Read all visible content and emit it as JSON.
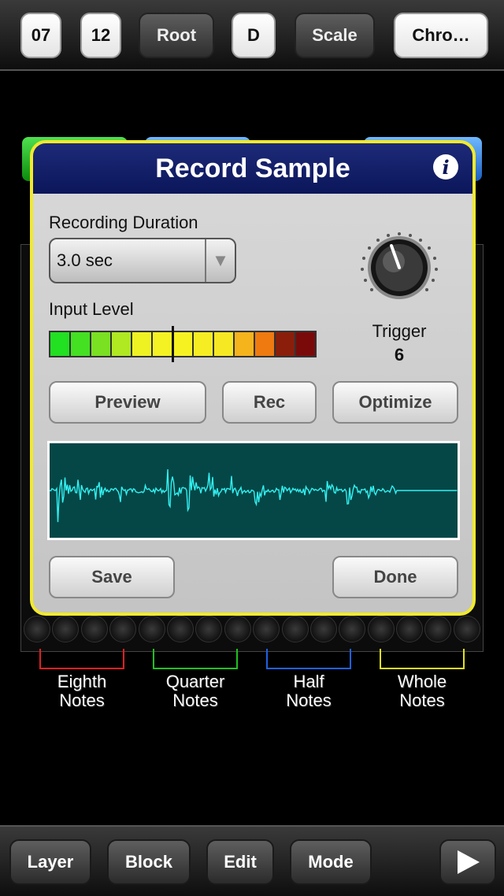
{
  "toolbar": {
    "items": [
      "07",
      "12",
      "Root",
      "D",
      "Scale",
      "Chro…"
    ]
  },
  "dialog": {
    "title": "Record Sample",
    "duration_label": "Recording Duration",
    "duration_value": "3.0 sec",
    "input_level_label": "Input Level",
    "trigger_label": "Trigger",
    "trigger_value": "6",
    "buttons": {
      "preview": "Preview",
      "rec": "Rec",
      "optimize": "Optimize",
      "save": "Save",
      "done": "Done"
    }
  },
  "note_labels": [
    {
      "line1": "Eighth",
      "line2": "Notes",
      "color": "#e02020"
    },
    {
      "line1": "Quarter",
      "line2": "Notes",
      "color": "#20c020"
    },
    {
      "line1": "Half",
      "line2": "Notes",
      "color": "#2060e0"
    },
    {
      "line1": "Whole",
      "line2": "Notes",
      "color": "#e0e020"
    }
  ],
  "bottom_bar": {
    "layer": "Layer",
    "block": "Block",
    "edit": "Edit",
    "mode": "Mode"
  },
  "colors": {
    "dialog_border": "#f1ea2c",
    "header": "#0b165a",
    "waveform": "#33f0f0",
    "waveform_bg": "#054747"
  },
  "icons": [
    "info-icon",
    "dropdown-arrow-icon",
    "trigger-knob-icon",
    "play-icon"
  ]
}
